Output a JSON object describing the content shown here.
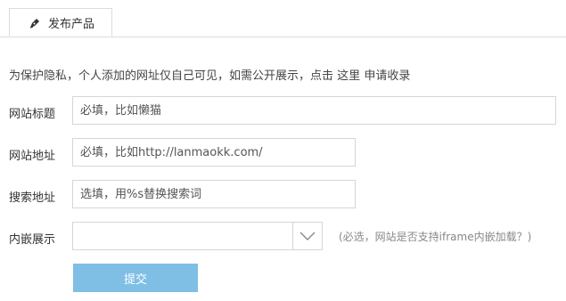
{
  "tab": {
    "label": "发布产品",
    "icon": "pen-icon"
  },
  "notice": {
    "text": "为保护隐私，个人添加的网址仅自己可见，如需公开展示，点击",
    "link": "这里",
    "suffix": "申请收录"
  },
  "form": {
    "title": {
      "label": "网站标题",
      "placeholder": "必填，比如懒猫"
    },
    "url": {
      "label": "网站地址",
      "placeholder": "必填，比如http://lanmaokk.com/"
    },
    "search_url": {
      "label": "搜索地址",
      "placeholder": "选填，用%s替换搜索词"
    },
    "embed": {
      "label": "内嵌展示",
      "value": "",
      "hint": "(必选，网站是否支持iframe内嵌加载？)"
    },
    "submit_label": "提交"
  },
  "colors": {
    "submit_bg": "#7fbfe6",
    "border": "#d6d6d6"
  }
}
